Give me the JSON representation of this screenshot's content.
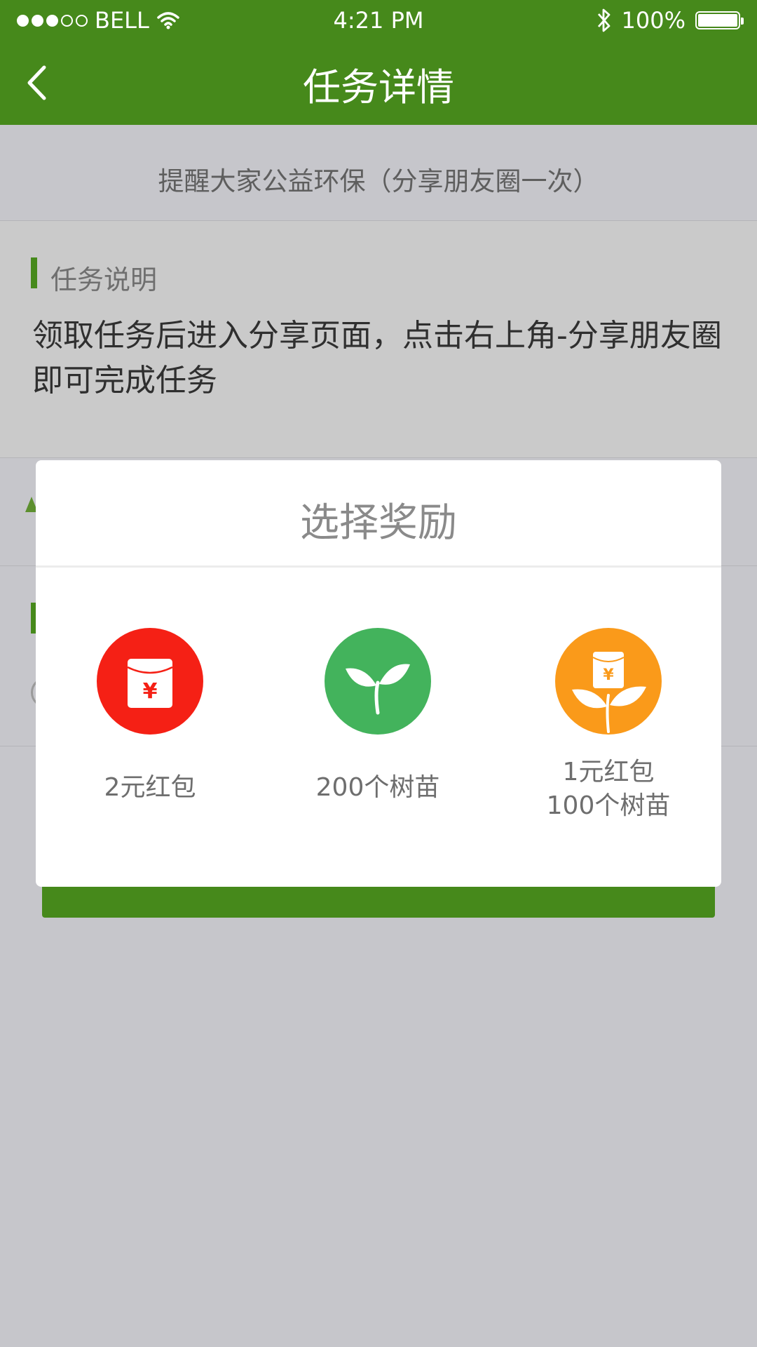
{
  "status_bar": {
    "carrier": "BELL",
    "time": "4:21 PM",
    "battery": "100%",
    "signal_icon": "signal-dots-icon",
    "wifi_icon": "wifi-icon",
    "bluetooth_icon": "bluetooth-icon"
  },
  "nav": {
    "title": "任务详情",
    "back_icon": "chevron-left-icon",
    "bar_color": "#46891b"
  },
  "task": {
    "title": "提醒大家公益环保（分享朋友圈一次）",
    "section_heading": "任务说明",
    "description": "领取任务后进入分享页面，点击右上角-分享朋友圈即可完成任务"
  },
  "modal": {
    "title": "选择奖励",
    "options": [
      {
        "label": "2元红包",
        "icon": "red-envelope-icon",
        "color": "#f52015"
      },
      {
        "label": "200个树苗",
        "icon": "sprout-icon",
        "color": "#43b35c"
      },
      {
        "label_line1": "1元红包",
        "label_line2": "100个树苗",
        "icon": "envelope-sprout-icon",
        "color": "#fa9a1a"
      }
    ]
  }
}
